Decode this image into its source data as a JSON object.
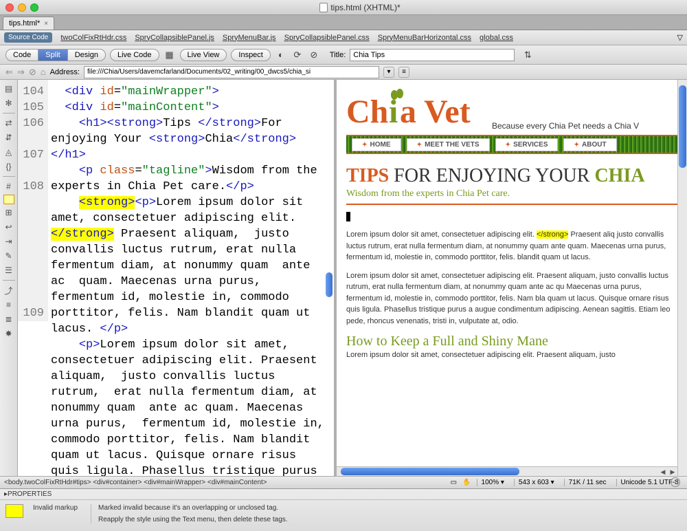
{
  "window": {
    "title": "tips.html (XHTML)*"
  },
  "tabs": {
    "file": "tips.html*"
  },
  "sourceBar": {
    "label": "Source Code",
    "files": [
      "twoColFixRtHdr.css",
      "SpryCollapsiblePanel.js",
      "SpryMenuBar.js",
      "SpryCollapsiblePanel.css",
      "SpryMenuBarHorizontal.css",
      "global.css"
    ]
  },
  "toolbar": {
    "views": [
      "Code",
      "Split",
      "Design"
    ],
    "liveCode": "Live Code",
    "liveView": "Live View",
    "inspect": "Inspect",
    "titleLabel": "Title:",
    "titleValue": "Chia Tips"
  },
  "addressBar": {
    "label": "Address:",
    "value": "file:///Chia/Users/davemcfarland/Documents/02_writing/00_dwcs5/chia_si"
  },
  "code": {
    "lineNumbers": [
      "104",
      "105",
      "106",
      "",
      "107",
      "",
      "108",
      "",
      "",
      "",
      "",
      "",
      "",
      "",
      "109"
    ]
  },
  "preview": {
    "logoAlt": "Chia Vet",
    "slogan": "Because every Chia Pet needs a Chia V",
    "nav": [
      "HOME",
      "MEET THE VETS",
      "SERVICES",
      "ABOUT"
    ],
    "h1": {
      "tips": "TIPS",
      "mid": " FOR ENJOYING YOUR ",
      "chia": "CHIA"
    },
    "tagline": "Wisdom from the experts in Chia Pet care.",
    "p1a": "Lorem ipsum dolor sit amet, consectetuer adipiscing elit. ",
    "p1strong": "</strong>",
    "p1b": " Praesent aliq justo convallis luctus rutrum, erat nulla fermentum diam, at nonummy quam ante quam. Maecenas urna purus, fermentum id, molestie in, commodo porttitor, felis. blandit quam ut lacus.",
    "p2": "Lorem ipsum dolor sit amet, consectetuer adipiscing elit. Praesent aliquam, justo convallis luctus rutrum, erat nulla fermentum diam, at nonummy quam ante ac qu Maecenas urna purus, fermentum id, molestie in, commodo porttitor, felis. Nam bla quam ut lacus. Quisque ornare risus quis ligula. Phasellus tristique purus a augue condimentum adipiscing. Aenean sagittis. Etiam leo pede, rhoncus venenatis, tristi in, vulputate at, odio.",
    "h2": "How to Keep a Full and Shiny Mane",
    "p3": "Lorem ipsum dolor sit amet, consectetuer adipiscing elit. Praesent aliquam, justo"
  },
  "status": {
    "breadcrumb": "<body.twoColFixRtHdr#tips> <div#container> <div#mainWrapper> <div#mainContent>",
    "zoom": "100%",
    "dims": "543 x 603",
    "size": "71K / 11 sec",
    "enc": "Unicode 5.1 UTF-8"
  },
  "properties": {
    "title": "PROPERTIES",
    "label": "Invalid markup",
    "msg1": "Marked invalid because it's an overlapping or unclosed tag.",
    "msg2": "Reapply the style using the Text menu, then delete these tags."
  }
}
